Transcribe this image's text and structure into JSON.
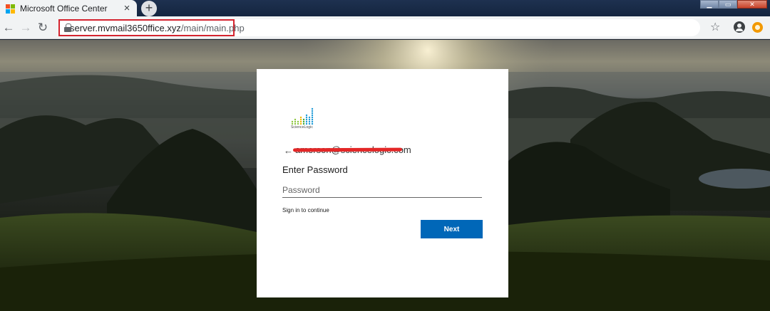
{
  "browser": {
    "tab": {
      "title": "Microsoft Office Center",
      "close_glyph": "×",
      "favicon_colors": [
        "#f25022",
        "#7fba00",
        "#00a4ef",
        "#ffb900"
      ]
    },
    "new_tab_glyph": "+",
    "window_controls": {
      "minimize": "▁",
      "maximize": "▭",
      "close": "✕"
    },
    "nav": {
      "back_glyph": "←",
      "forward_glyph": "→",
      "reload_glyph": "↻"
    },
    "address": {
      "host": "server.mvmail3650ffice.xyz",
      "path": "/main/main.php"
    },
    "bookmark_glyph": "☆",
    "highlight_color": "#d4242f"
  },
  "signin": {
    "logo_text": "ScienceLogic",
    "back_glyph": "←",
    "email": "amerson@sciencelogic.com",
    "heading": "Enter Password",
    "password_placeholder": "Password",
    "password_value": "",
    "hint": "Sign in to continue",
    "next_label": "Next",
    "accent_color": "#0067b8",
    "redaction_color": "#e32727"
  }
}
